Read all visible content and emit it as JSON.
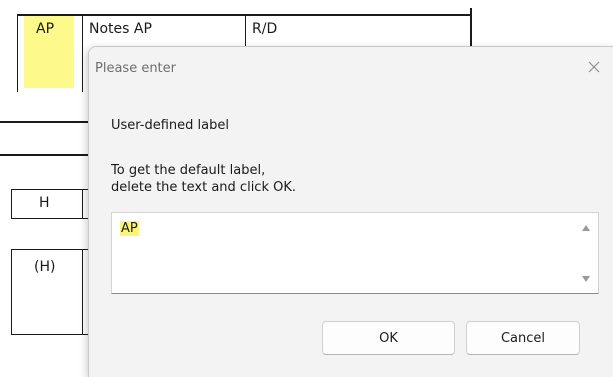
{
  "background": {
    "header_cells": [
      "AP",
      "Notes AP",
      "R/D"
    ],
    "ap_cell_color": "#fdf98a",
    "row_h_label": "H",
    "row_paren_h_label": "(H)"
  },
  "dialog": {
    "title": "Please enter",
    "close_icon": "close-icon",
    "label": "User-defined label",
    "instruction_line1": "To get the default label,",
    "instruction_line2": "delete the text and click OK.",
    "input_value": "AP",
    "input_highlight_color": "#fbf37a",
    "ok_label": "OK",
    "cancel_label": "Cancel"
  }
}
